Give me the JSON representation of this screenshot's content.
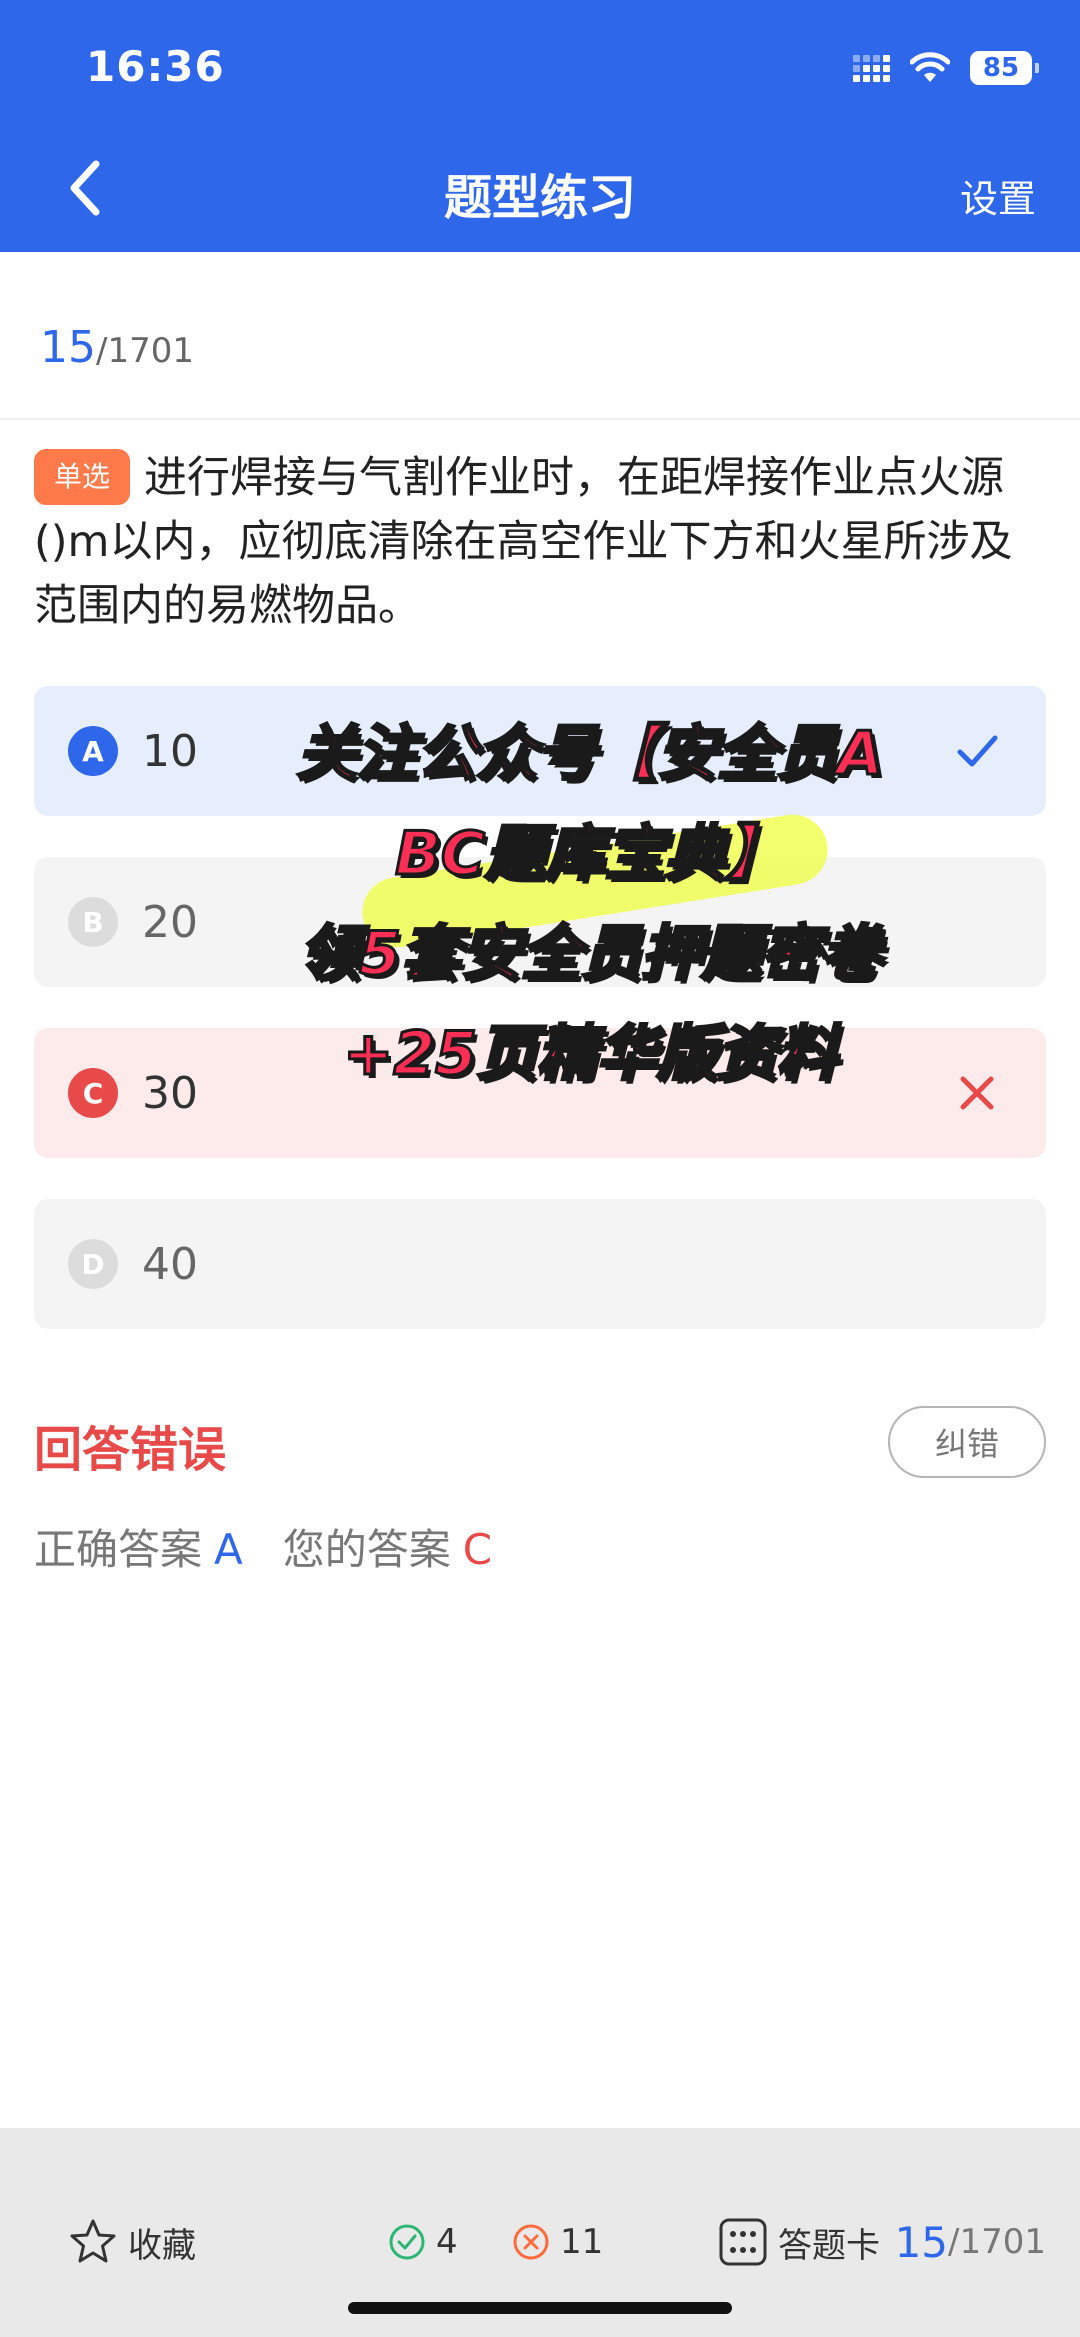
{
  "status": {
    "time": "16:36",
    "battery": "85"
  },
  "header": {
    "title": "题型练习",
    "settings_label": "设置"
  },
  "progress": {
    "current": "15",
    "total": "/1701"
  },
  "question": {
    "type": "单选",
    "text": "进行焊接与气割作业时，在距焊接作业点火源()m以内，应彻底清除在高空作业下方和火星所涉及范围内的易燃物品。"
  },
  "options": [
    {
      "letter": "A",
      "text": "10",
      "state": "correct"
    },
    {
      "letter": "B",
      "text": "20",
      "state": "normal"
    },
    {
      "letter": "C",
      "text": "30",
      "state": "wrong"
    },
    {
      "letter": "D",
      "text": "40",
      "state": "normal"
    }
  ],
  "overlay": {
    "line1": "关注公众号【安全员A",
    "line2": "BC题库宝典】",
    "line3": "领5套安全员押题密卷",
    "line4": "+25页精华版资料"
  },
  "result": {
    "title": "回答错误",
    "report_label": "纠错",
    "correct_label": "正确答案",
    "correct_value": "A",
    "yours_label": "您的答案",
    "yours_value": "C"
  },
  "bottom": {
    "favorite_label": "收藏",
    "right_count": "4",
    "wrong_count": "11",
    "card_label": "答题卡",
    "current": "15",
    "total": "/1701"
  },
  "colors": {
    "primary": "#2f67ea",
    "error": "#e84a4a",
    "badge": "#ff7a4a"
  }
}
